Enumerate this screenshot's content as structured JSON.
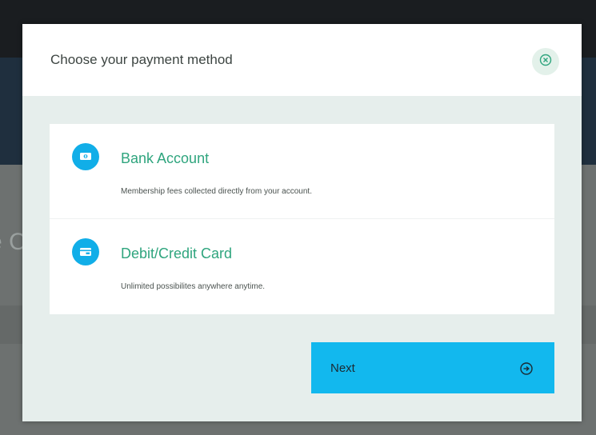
{
  "modal": {
    "title": "Choose your payment method",
    "close_icon": "close-circle-icon"
  },
  "options": [
    {
      "title": "Bank Account",
      "description": "Membership fees collected directly from your account.",
      "icon": "bank-icon"
    },
    {
      "title": "Debit/Credit Card",
      "description": "Unlimited possibilites anywhere anytime.",
      "icon": "card-icon"
    }
  ],
  "next_button": {
    "label": "Next",
    "icon": "arrow-right-circle-icon"
  },
  "colors": {
    "accent_blue": "#12b8ee",
    "option_title_green": "#2fa57e",
    "modal_body": "#e6eeec"
  }
}
